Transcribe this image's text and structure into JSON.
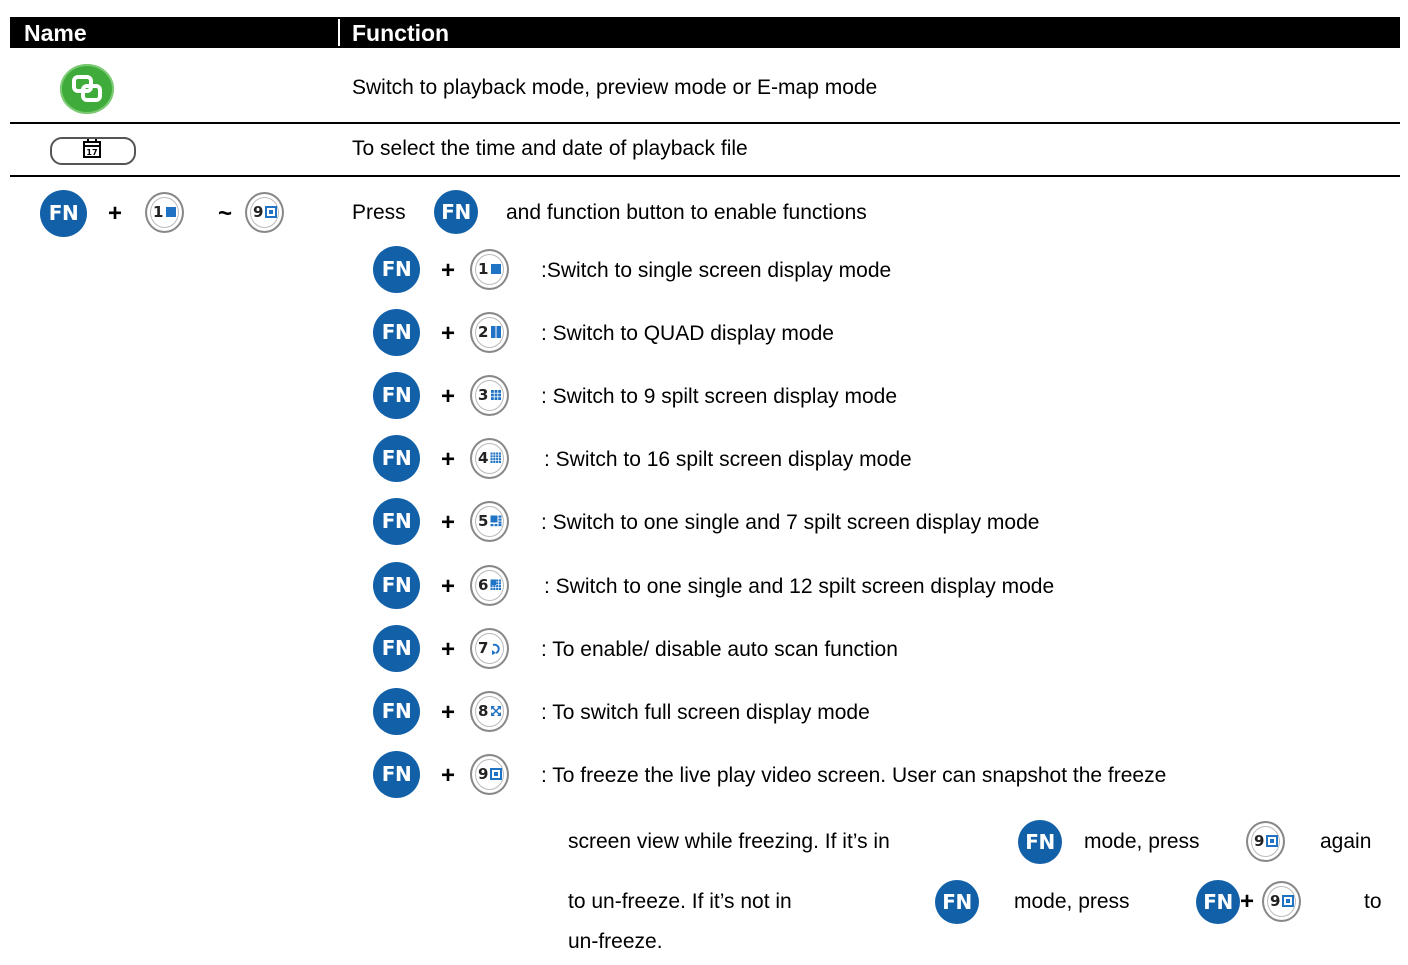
{
  "header": {
    "name": "Name",
    "function": "Function"
  },
  "rows": {
    "switch_mode": {
      "icon": "switch-mode-icon",
      "desc": "Switch to playback mode, preview mode or E-map mode"
    },
    "calendar": {
      "icon": "calendar-icon",
      "icon_text": "17",
      "desc": "To select the time and date of playback file"
    },
    "fn_combo": {
      "fn_label": "FN",
      "plus": "+",
      "tilde": "~",
      "key_first": "1",
      "key_last": "9",
      "intro_before": "Press",
      "intro_after": "and function button to enable functions"
    }
  },
  "fn_items": [
    {
      "num": "1",
      "icon": "single-screen-icon",
      "desc": ":Switch to single screen display mode"
    },
    {
      "num": "2",
      "icon": "quad-screen-icon",
      "desc": ": Switch to QUAD display mode"
    },
    {
      "num": "3",
      "icon": "nine-split-icon",
      "desc": ": Switch to 9 spilt screen display mode"
    },
    {
      "num": "4",
      "icon": "sixteen-split-icon",
      "desc": ": Switch to 16 spilt screen display mode"
    },
    {
      "num": "5",
      "icon": "one-plus-seven-icon",
      "desc": ": Switch to one single and 7 spilt screen display mode"
    },
    {
      "num": "6",
      "icon": "one-plus-twelve-icon",
      "desc": ": Switch to one single and 12 spilt screen display mode"
    },
    {
      "num": "7",
      "icon": "auto-scan-icon",
      "desc": ": To enable/ disable auto scan function"
    },
    {
      "num": "8",
      "icon": "full-screen-icon",
      "desc": ": To switch full screen display mode"
    },
    {
      "num": "9",
      "icon": "freeze-icon",
      "desc": ": To freeze the live play video screen. User can snapshot the freeze"
    }
  ],
  "freeze_note": {
    "line1_a": "screen view while freezing. If it’s in",
    "line1_b": "mode, press",
    "line1_c": "again",
    "line2_a": "to un-freeze. If it’s not in",
    "line2_b": "mode, press",
    "line2_c": "to",
    "line3": "un-freeze."
  },
  "colors": {
    "fn_blue": "#1160a8",
    "switch_green": "#3eab3a",
    "key_icon_blue": "#1f72c4",
    "header_bg": "#000000"
  }
}
